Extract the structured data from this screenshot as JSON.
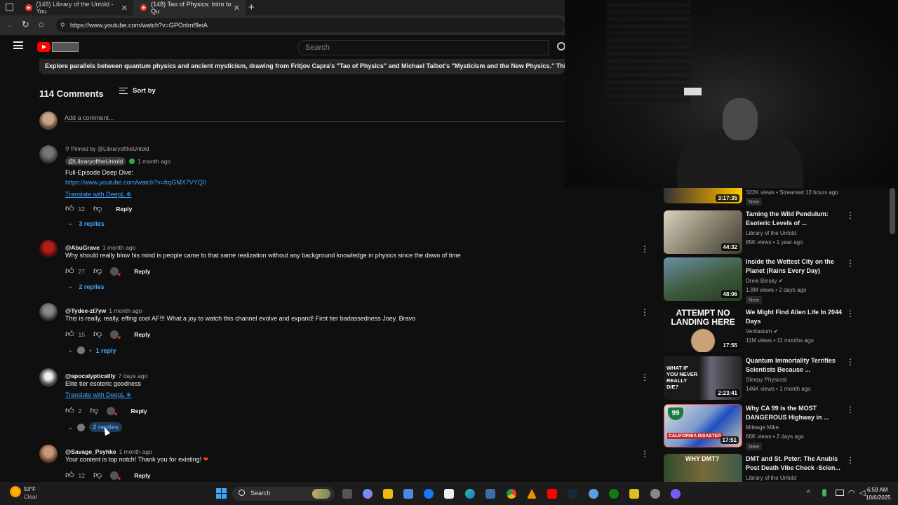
{
  "browser": {
    "tabs": [
      {
        "title": "(148) Library of the Untold - You"
      },
      {
        "title": "(148) Tao of Physics: Intro to Qu"
      }
    ],
    "url": "https://www.youtube.com/watch?v=GPOnlmf9eiA"
  },
  "header": {
    "search_placeholder": "Search"
  },
  "description": "Explore parallels between quantum physics and ancient mysticism, drawing from Fritjov Capra's \"Tao of Physics\" and Michael Talbot's \"Mysticism and the New Physics.\" This intro e",
  "comments_header": {
    "count_label": "114 Comments",
    "sort_label": "Sort by",
    "add_placeholder": "Add a comment..."
  },
  "comments": [
    {
      "pinned": "Pinned by @LibraryoftheUntold",
      "handle": "@LibraryoftheUntold",
      "time": "1 month ago",
      "text": "Full-Episode Deep Dive:",
      "link": "https://www.youtube.com/watch?v=frqGMX7VYQ0",
      "translate": "Translate with DeepL",
      "likes": "12",
      "reply": "Reply",
      "replies": "3 replies"
    },
    {
      "handle": "@AbuGrave",
      "time": "1 month ago",
      "text": "Why should really blow his mind is people came to that same realization without any background knowledge in physics since the dawn of time",
      "likes": "27",
      "reply": "Reply",
      "replies": "2 replies"
    },
    {
      "handle": "@Tydee-zt7yw",
      "time": "1 month ago",
      "text": "This is really, really, effing cool AF!!! What a joy to watch this channel evolve and expand! First tier badassedness Joey.  Bravo",
      "likes": "15",
      "reply": "Reply",
      "replies": "1 reply"
    },
    {
      "handle": "@apocalypticallly",
      "time": "7 days ago",
      "text": "Elite tier esoteric goodness",
      "translate": "Translate with DeepL",
      "likes": "2",
      "reply": "Reply",
      "replies": "2 replies"
    },
    {
      "handle": "@Savage_Psyhke",
      "time": "1 month ago",
      "text": "Your content is top notch! Thank you for existing! ",
      "likes": "12",
      "reply": "Reply"
    }
  ],
  "sidebar": [
    {
      "duration": "3:17:35",
      "meta": "322K views • Streamed 12 hours ago",
      "badge": "New"
    },
    {
      "title": "Taming the Wild Pendulum: Esoteric Levels of ...",
      "channel": "Library of the Untold",
      "meta": "85K views • 1 year ago",
      "duration": "44:32"
    },
    {
      "title": "Inside the Wettest City on the Planet (Rains Every Day)",
      "channel": "Drew Binsky",
      "meta": "1.8M views • 2 days ago",
      "duration": "48:06",
      "badge": "New"
    },
    {
      "title": "We Might Find Alien Life In 2044 Days",
      "channel": "Veritasium",
      "meta": "11M views • 11 months ago",
      "duration": "17:55",
      "thumb_text": "ATTEMPT NO LANDING HERE"
    },
    {
      "title": "Quantum Immortality Terrifies Scientists Because ...",
      "channel": "Sleepy Physicist",
      "meta": "146K views • 1 month ago",
      "duration": "2:23:41",
      "thumb_text": "WHAT IF YOU NEVER REALLY DIE?"
    },
    {
      "title": "Why CA 99 is the MOST DANGEROUS Highway in ...",
      "channel": "Mileage Mike",
      "meta": "66K views • 2 days ago",
      "duration": "17:51",
      "badge": "New",
      "thumb_text": "CALIFORNIA DISASTER"
    },
    {
      "title": "DMT and St. Peter: The Anubis Post Death Vibe Check -Scien...",
      "channel": "Library of the Untold",
      "thumb_text": "WHY DMT?"
    }
  ],
  "taskbar": {
    "weather_temp": "53°F",
    "weather_cond": "Clear",
    "search_label": "Search",
    "time": "6:59 AM",
    "date": "10/6/2025"
  },
  "colors": {
    "accent": "#3ea6ff",
    "bg": "#0f0f0f",
    "youtube_red": "#ff0000"
  }
}
